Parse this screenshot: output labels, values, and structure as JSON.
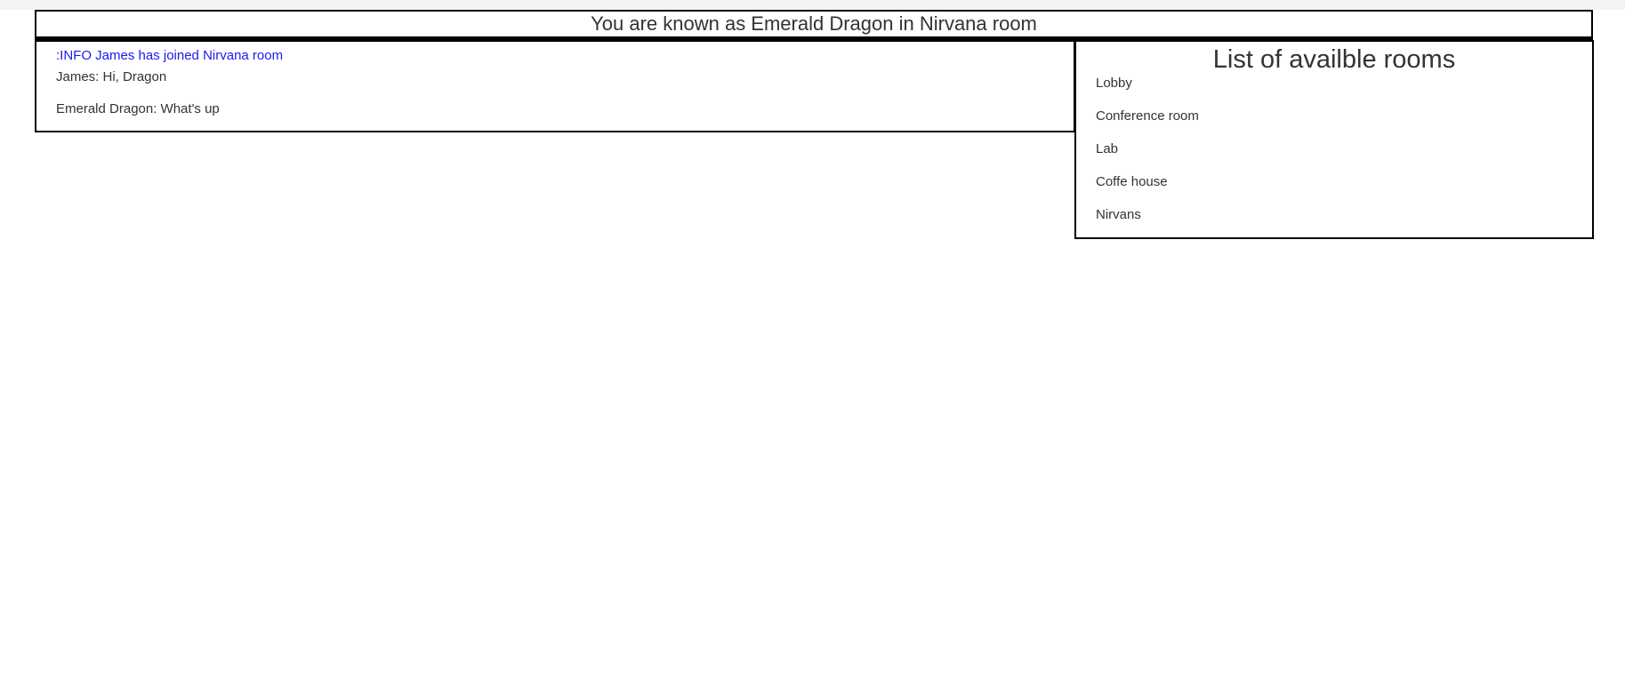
{
  "header": {
    "title": "You are known as Emerald Dragon in Nirvana room"
  },
  "chat": {
    "messages": [
      {
        "type": "info",
        "text": ":INFO James has joined Nirvana room"
      },
      {
        "type": "message",
        "text": "James: Hi, Dragon"
      },
      {
        "type": "message",
        "text": "Emerald Dragon: What's up"
      }
    ]
  },
  "rooms": {
    "title": "List of availble rooms",
    "items": [
      "Lobby",
      "Conference room",
      "Lab",
      "Coffe house",
      "Nirvans"
    ]
  },
  "colors": {
    "info_text": "#1a1af2",
    "text": "#333333",
    "border": "#000000"
  }
}
